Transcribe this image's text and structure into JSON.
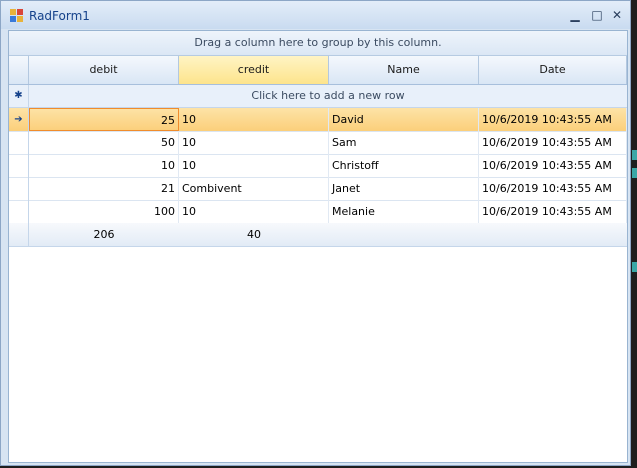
{
  "window": {
    "title": "RadForm1",
    "controls": {
      "minimize": "▁",
      "maximize": "□",
      "close": "✕"
    }
  },
  "grid": {
    "group_panel_text": "Drag a column here to group by this column.",
    "columns": [
      {
        "header": "debit"
      },
      {
        "header": "credit"
      },
      {
        "header": "Name"
      },
      {
        "header": "Date"
      }
    ],
    "selected_column": "credit",
    "new_row_text": "Click here to add a new row",
    "new_row_icon": "asterisk-icon",
    "current_row_icon": "row-arrow-icon",
    "rows": [
      {
        "debit": "25",
        "credit": "10",
        "name": "David",
        "date": "10/6/2019 10:43:55 AM"
      },
      {
        "debit": "50",
        "credit": "10",
        "name": "Sam",
        "date": "10/6/2019 10:43:55 AM"
      },
      {
        "debit": "10",
        "credit": "10",
        "name": "Christoff",
        "date": "10/6/2019 10:43:55 AM"
      },
      {
        "debit": "21",
        "credit": "Combivent",
        "name": "Janet",
        "date": "10/6/2019 10:43:55 AM"
      },
      {
        "debit": "100",
        "credit": "10",
        "name": "Melanie",
        "date": "10/6/2019 10:43:55 AM"
      }
    ],
    "summary": {
      "debit": "206",
      "credit": "40"
    }
  },
  "colors": {
    "accent": "#15428b",
    "current_row": "#fbcf7a",
    "selected_header": "#fde48c",
    "focus_border": "#f08c2c"
  }
}
